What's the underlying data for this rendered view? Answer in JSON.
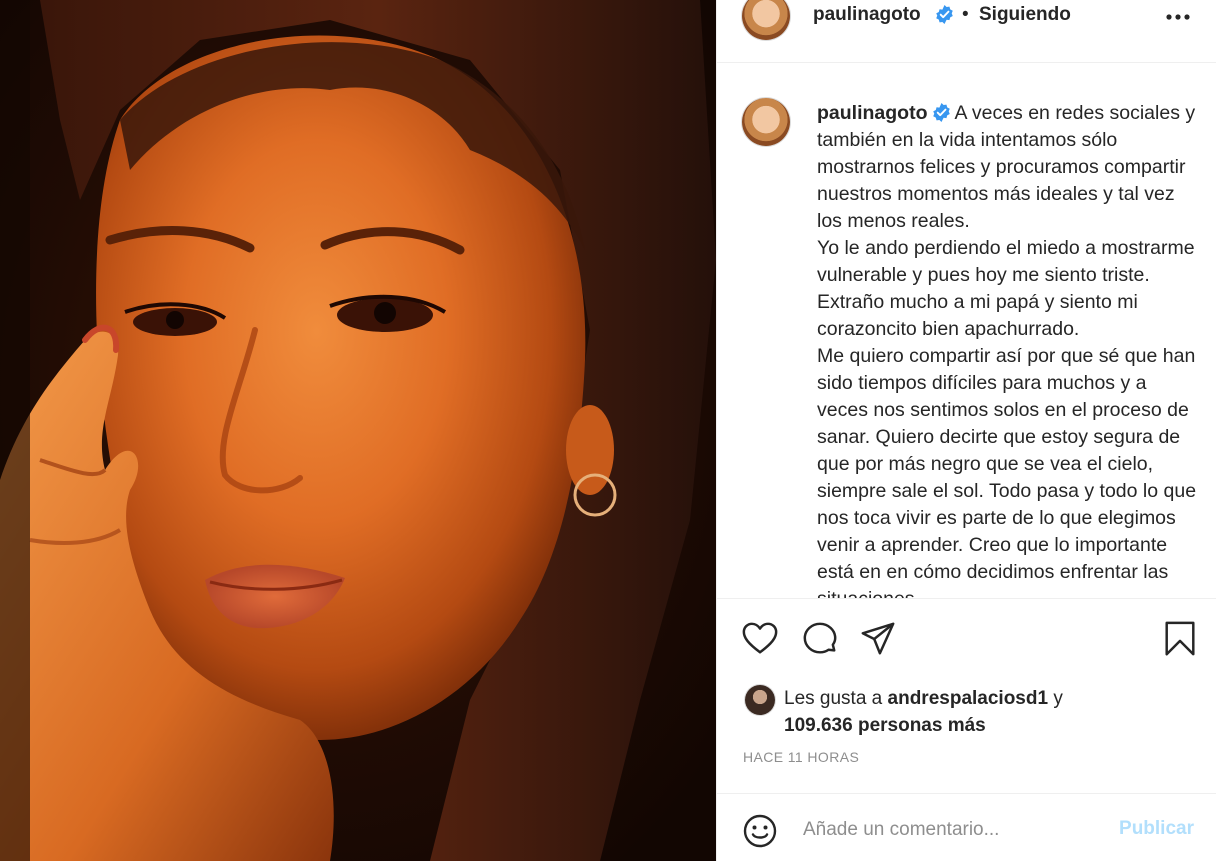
{
  "post": {
    "photo_icon": "portrait-photo",
    "photo_tones": {
      "background": "#1c0c05",
      "skin": "#e0722a",
      "hair": "#2a1109"
    }
  },
  "header": {
    "username": "paulinagoto",
    "separator": "•",
    "follow_status": "Siguiendo",
    "more_icon": "more-horizontal-icon",
    "verified_icon": "verified-badge-icon"
  },
  "caption": {
    "username": "paulinagoto",
    "paragraphs": [
      "A veces en redes sociales y también en la vida intentamos sólo mostrarnos felices y procuramos compartir nuestros momentos más ideales y tal vez los menos reales.",
      "Yo le ando perdiendo el miedo a mostrarme vulnerable y pues hoy me siento triste. Extraño mucho a mi papá y siento mi corazoncito bien apachurrado.",
      "Me quiero compartir así por que sé que han sido tiempos difíciles para muchos y a veces nos sentimos solos en el proceso de sanar. Quiero decirte que estoy segura de que por más negro que se vea el cielo, siempre sale el sol. Todo pasa y todo lo que nos toca vivir es parte de lo que elegimos venir a aprender. Creo que lo importante está en en cómo decidimos enfrentar las situaciones."
    ]
  },
  "actions": {
    "like_icon": "heart-icon",
    "comment_icon": "comment-bubble-icon",
    "share_icon": "paper-plane-icon",
    "save_icon": "bookmark-icon"
  },
  "likes": {
    "prefix": "Les gusta a ",
    "user": "andrespalaciosd1",
    "connector": " y",
    "count_text": "109.636 personas más"
  },
  "timestamp": "HACE 11 HORAS",
  "comment": {
    "emoji_icon": "emoji-smile-icon",
    "placeholder": "Añade un comentario...",
    "publish_label": "Publicar",
    "publish_color": "#b2dffc"
  },
  "colors": {
    "verified_blue": "#3897f0",
    "text": "#262626",
    "muted": "#8e8e8e",
    "border": "#efefef"
  }
}
